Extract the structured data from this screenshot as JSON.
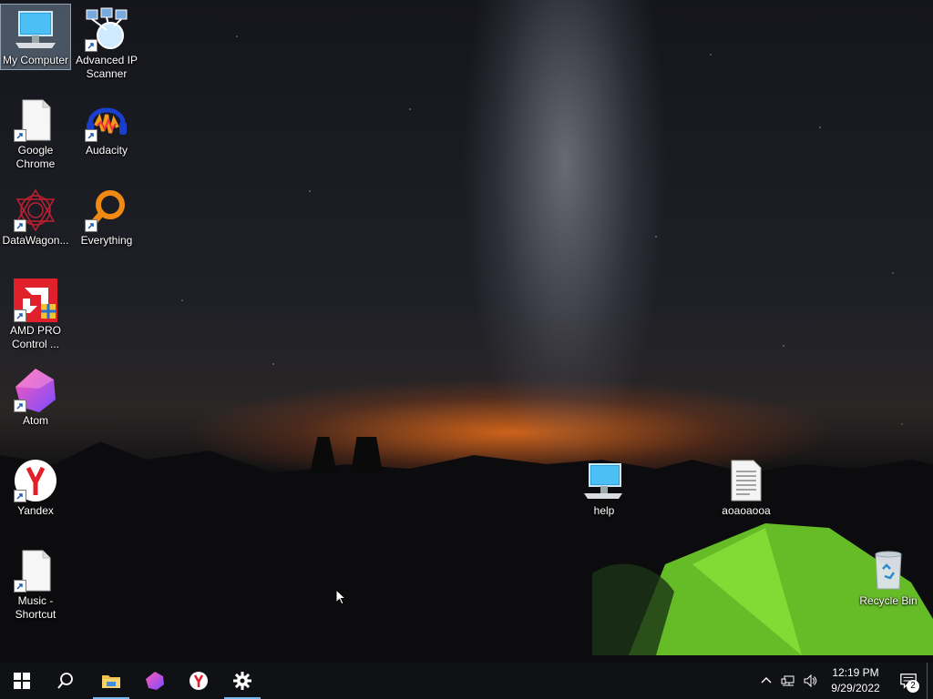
{
  "desktop": {
    "icons": [
      {
        "label": "My Computer",
        "icon": "monitor-icon"
      },
      {
        "label": "Advanced IP Scanner",
        "icon": "network-scanner-icon"
      },
      {
        "label": "Google Chrome",
        "icon": "blank-file-icon"
      },
      {
        "label": "Audacity",
        "icon": "audacity-icon"
      },
      {
        "label": "DataWagon...",
        "icon": "datawagon-icon"
      },
      {
        "label": "Everything",
        "icon": "everything-search-icon"
      },
      {
        "label": "AMD PRO Control ...",
        "icon": "amd-icon"
      },
      {
        "label": "Atom",
        "icon": "atom-icon"
      },
      {
        "label": "Yandex",
        "icon": "yandex-icon"
      },
      {
        "label": "Music - Shortcut",
        "icon": "blank-file-icon"
      },
      {
        "label": "help",
        "icon": "monitor-icon"
      },
      {
        "label": "aoaoaooa",
        "icon": "text-file-icon"
      },
      {
        "label": "Recycle Bin",
        "icon": "recycle-bin-icon"
      }
    ]
  },
  "taskbar": {
    "apps": [
      "start-icon",
      "search-icon",
      "file-explorer-icon",
      "atom-icon",
      "yandex-icon",
      "settings-icon"
    ],
    "clock": {
      "time": "12:19 PM",
      "date": "9/29/2022"
    },
    "notifications": {
      "count": "2"
    }
  },
  "colors": {
    "taskbar": "#101114",
    "accent": "#76b9ed",
    "selection": "#aac8e6"
  }
}
